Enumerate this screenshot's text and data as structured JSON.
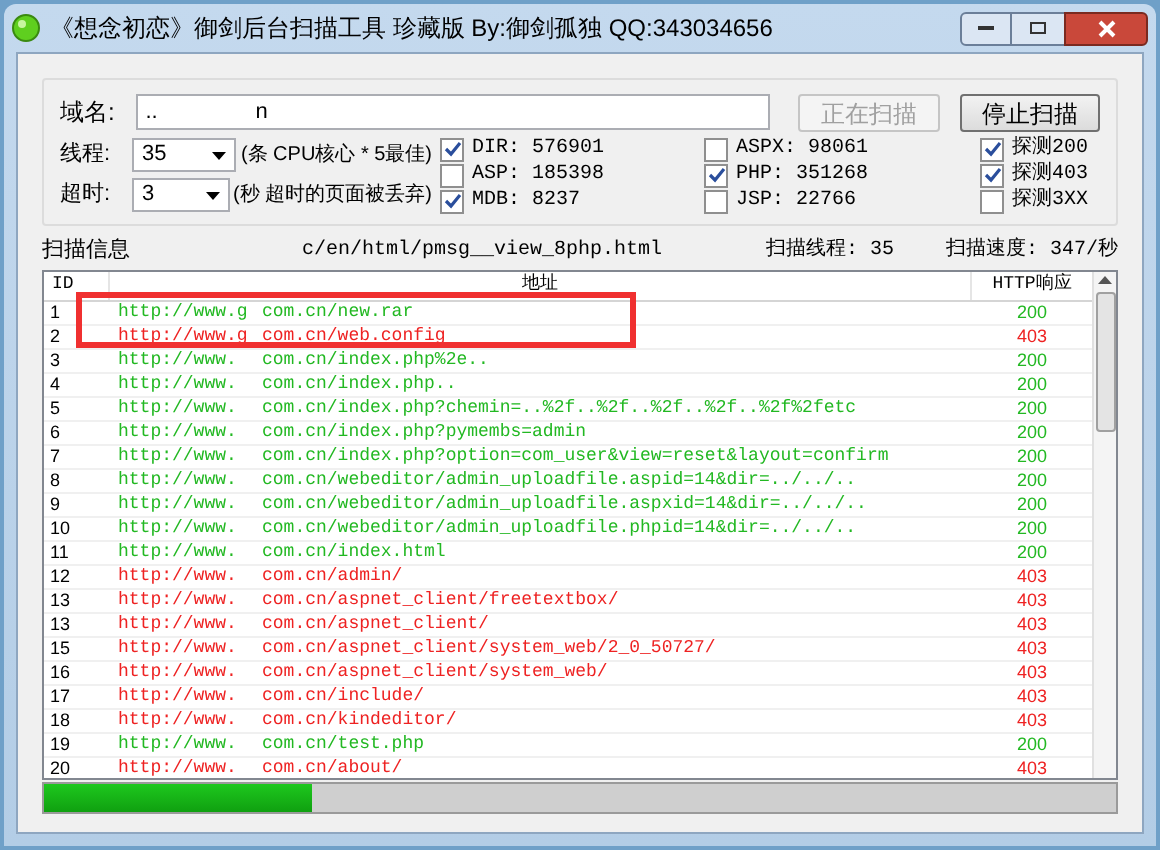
{
  "window": {
    "title": "《想念初恋》御剑后台扫描工具 珍藏版 By:御剑孤独 QQ:343034656"
  },
  "domain": {
    "label": "域名:",
    "value": "..                n"
  },
  "buttons": [
    {
      "label": "正在扫描",
      "disabled": true
    },
    {
      "label": "停止扫描",
      "disabled": false
    }
  ],
  "threads": {
    "label": "线程:",
    "value": "35",
    "hint": "(条 CPU核心 * 5最佳)"
  },
  "timeout": {
    "label": "超时:",
    "value": "3",
    "hint": "(秒 超时的页面被丢弃)"
  },
  "dictionaries": [
    {
      "label": "DIR: 576901",
      "checked": true
    },
    {
      "label": "ASP: 185398",
      "checked": false
    },
    {
      "label": "MDB: 8237",
      "checked": true
    },
    {
      "label": "ASPX: 98061",
      "checked": false
    },
    {
      "label": "PHP: 351268",
      "checked": true
    },
    {
      "label": "JSP: 22766",
      "checked": false
    }
  ],
  "detect": [
    {
      "label": "探测200",
      "checked": true
    },
    {
      "label": "探测403",
      "checked": true
    },
    {
      "label": "探测3XX",
      "checked": false
    }
  ],
  "scan_info": {
    "label": "扫描信息",
    "current": "c/en/html/pmsg__view_8php.html",
    "threads": "扫描线程: 35",
    "speed": "扫描速度: 347/秒"
  },
  "table": {
    "columns": [
      "ID",
      "地址",
      "HTTP响应"
    ],
    "rows": [
      {
        "id": "1",
        "prefix": "http://www.g",
        "path": "com.cn/new.rar",
        "status": "200",
        "ok": true
      },
      {
        "id": "2",
        "prefix": "http://www.g",
        "path": "com.cn/web.config",
        "status": "403",
        "ok": false
      },
      {
        "id": "3",
        "prefix": "http://www.",
        "path": "com.cn/index.php%2e..",
        "status": "200",
        "ok": true
      },
      {
        "id": "4",
        "prefix": "http://www.",
        "path": "com.cn/index.php..",
        "status": "200",
        "ok": true
      },
      {
        "id": "5",
        "prefix": "http://www.",
        "path": "com.cn/index.php?chemin=..%2f..%2f..%2f..%2f..%2f%2fetc",
        "status": "200",
        "ok": true
      },
      {
        "id": "6",
        "prefix": "http://www.",
        "path": "com.cn/index.php?pymembs=admin",
        "status": "200",
        "ok": true
      },
      {
        "id": "7",
        "prefix": "http://www.",
        "path": "com.cn/index.php?option=com_user&view=reset&layout=confirm",
        "status": "200",
        "ok": true
      },
      {
        "id": "8",
        "prefix": "http://www.",
        "path": "com.cn/webeditor/admin_uploadfile.aspid=14&dir=../../..",
        "status": "200",
        "ok": true
      },
      {
        "id": "9",
        "prefix": "http://www.",
        "path": "com.cn/webeditor/admin_uploadfile.aspxid=14&dir=../../..",
        "status": "200",
        "ok": true
      },
      {
        "id": "10",
        "prefix": "http://www.",
        "path": "com.cn/webeditor/admin_uploadfile.phpid=14&dir=../../..",
        "status": "200",
        "ok": true
      },
      {
        "id": "11",
        "prefix": "http://www.",
        "path": "com.cn/index.html",
        "status": "200",
        "ok": true
      },
      {
        "id": "12",
        "prefix": "http://www.",
        "path": "com.cn/admin/",
        "status": "403",
        "ok": false
      },
      {
        "id": "13",
        "prefix": "http://www.",
        "path": "com.cn/aspnet_client/freetextbox/",
        "status": "403",
        "ok": false
      },
      {
        "id": "13",
        "prefix": "http://www.",
        "path": "com.cn/aspnet_client/",
        "status": "403",
        "ok": false
      },
      {
        "id": "15",
        "prefix": "http://www.",
        "path": "com.cn/aspnet_client/system_web/2_0_50727/",
        "status": "403",
        "ok": false
      },
      {
        "id": "16",
        "prefix": "http://www.",
        "path": "com.cn/aspnet_client/system_web/",
        "status": "403",
        "ok": false
      },
      {
        "id": "17",
        "prefix": "http://www.",
        "path": "com.cn/include/",
        "status": "403",
        "ok": false
      },
      {
        "id": "18",
        "prefix": "http://www.",
        "path": "com.cn/kindeditor/",
        "status": "403",
        "ok": false
      },
      {
        "id": "19",
        "prefix": "http://www.",
        "path": "com.cn/test.php",
        "status": "200",
        "ok": true
      },
      {
        "id": "20",
        "prefix": "http://www.",
        "path": "com.cn/about/",
        "status": "403",
        "ok": false
      }
    ]
  },
  "progress": {
    "level": 0.25
  }
}
